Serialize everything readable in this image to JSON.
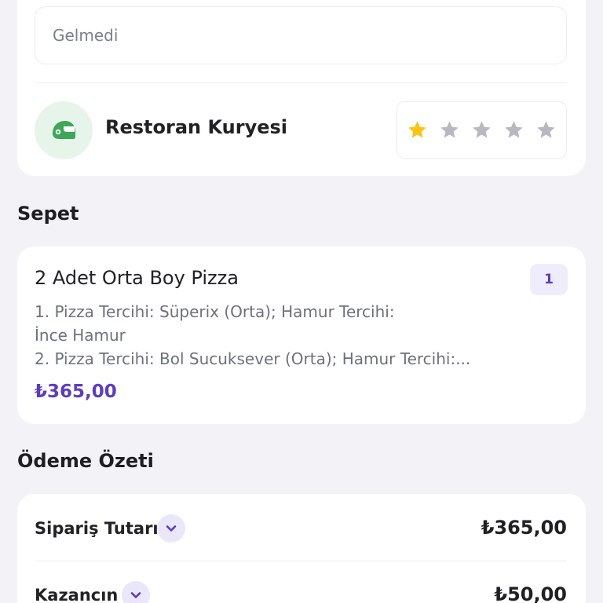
{
  "feedback": {
    "note_value": "Gelmedi"
  },
  "courier": {
    "name": "Restoran Kuryesi",
    "icon": "courier-helmet-icon",
    "rating": 1,
    "max_rating": 5
  },
  "cart": {
    "title": "Sepet",
    "items": [
      {
        "name": "2 Adet Orta Boy Pizza",
        "quantity": "1",
        "description_lines": [
          "1. Pizza Tercihi: Süperix (Orta); Hamur Tercihi:",
          "İnce Hamur",
          "2. Pizza Tercihi: Bol Sucuksever (Orta); Hamur Tercihi:..."
        ],
        "price": "₺365,00"
      }
    ]
  },
  "payment_summary": {
    "title": "Ödeme Özeti",
    "rows": [
      {
        "label": "Sipariş Tutarı",
        "value": "₺365,00"
      },
      {
        "label": "Kazancın",
        "value": "₺50,00"
      }
    ]
  },
  "colors": {
    "accent": "#5b3cc4",
    "star_filled": "#ffc20e",
    "star_empty": "#b8b9c0",
    "courier_green": "#3da858"
  }
}
